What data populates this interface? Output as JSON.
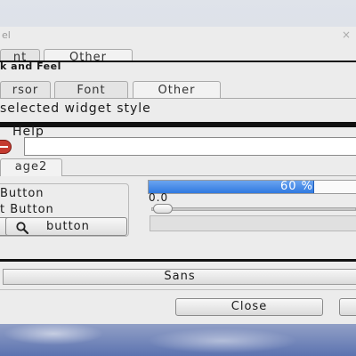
{
  "prefs_window": {
    "title": "el",
    "close_glyph": "×",
    "tabs": [
      {
        "label": "nt"
      },
      {
        "label": "Other"
      }
    ],
    "look_and_feel": {
      "header": "k and Feel",
      "sub_tabs": [
        {
          "label": "rsor"
        },
        {
          "label": "Font"
        },
        {
          "label": "Other"
        }
      ],
      "description": "selected widget style"
    }
  },
  "preview_window": {
    "menu": {
      "help_label": "Help"
    },
    "entry": {
      "value": ""
    },
    "notebook": {
      "tab_label": "age2"
    },
    "left_frame": {
      "radio_label": "Button",
      "check_label": "t Button",
      "search_button_label": "button"
    },
    "progress": {
      "value": 0.6,
      "text": "60 %"
    },
    "scale": {
      "value_text": "0.0",
      "value": 0.0
    }
  },
  "font_panel": {
    "font_button_label": "Sans",
    "close_label": "Close"
  },
  "colors": {
    "accent": "#3079e0",
    "stop_icon": "#c43a2f",
    "window_bg": "#ececec"
  },
  "icons": [
    "stop-icon",
    "search-icon",
    "close-icon"
  ]
}
